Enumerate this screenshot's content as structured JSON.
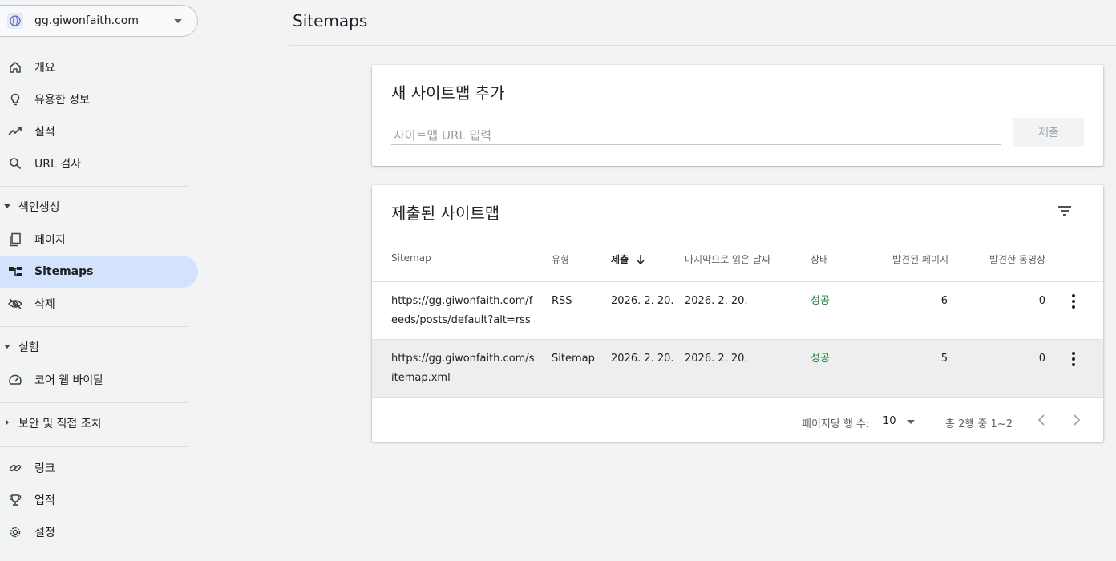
{
  "property": {
    "domain": "gg.giwonfaith.com"
  },
  "nav": {
    "overview": "개요",
    "insights": "유용한 정보",
    "performance": "실적",
    "url_inspection": "URL 검사",
    "indexing_section": "색인생성",
    "pages": "페이지",
    "sitemaps": "Sitemaps",
    "removals": "삭제",
    "experience_section": "실험",
    "core_web_vitals": "코어 웹 바이탈",
    "security_section": "보안 및 직접 조치",
    "links": "링크",
    "achievements": "업적",
    "settings": "설정"
  },
  "header": {
    "title": "Sitemaps"
  },
  "add_sitemap": {
    "title": "새 사이트맵 추가",
    "placeholder": "사이트맵 URL 입력",
    "submit_label": "제출"
  },
  "submitted": {
    "title": "제출된 사이트맵",
    "columns": [
      "Sitemap",
      "유형",
      "제출",
      "마지막으로 읽은 날짜",
      "상태",
      "발견된 페이지",
      "발견한 동영상"
    ],
    "rows": [
      {
        "sitemap": "https://gg.giwonfaith.com/feeds/posts/default?alt=rss",
        "type": "RSS",
        "submitted": "2026. 2. 20.",
        "last_read": "2026. 2. 20.",
        "status": "성공",
        "pages": "6",
        "videos": "0"
      },
      {
        "sitemap": "https://gg.giwonfaith.com/sitemap.xml",
        "type": "Sitemap",
        "submitted": "2026. 2. 20.",
        "last_read": "2026. 2. 20.",
        "status": "성공",
        "pages": "5",
        "videos": "0"
      }
    ],
    "footer": {
      "rows_per_page_label": "페이지당 행 수:",
      "rows_per_page": "10",
      "range": "총 2행 중 1~2"
    }
  },
  "colors": {
    "active_nav": "#d3e3fd",
    "success": "#188038"
  }
}
